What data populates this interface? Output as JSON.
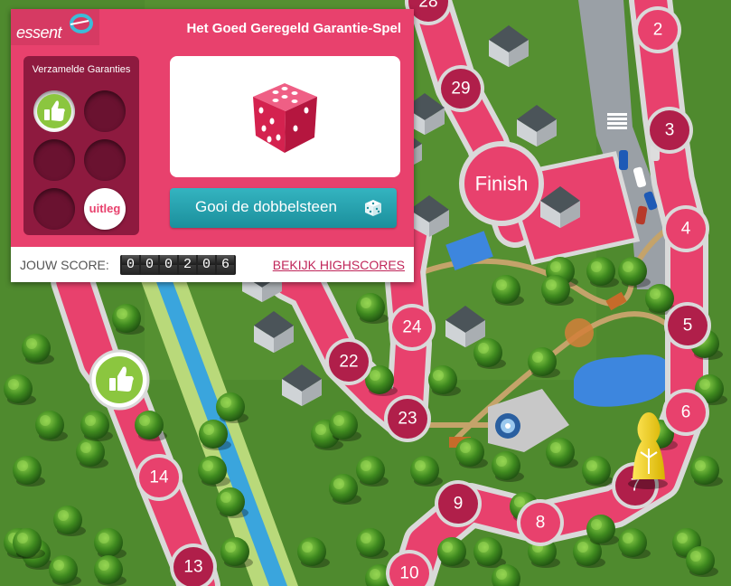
{
  "panel": {
    "logo": "essent",
    "title": "Het Goed Geregeld Garantie-Spel",
    "collected_title": "Verzamelde Garanties",
    "badge_text": "Goed Geregeld Garantie",
    "help_button": "uitleg",
    "roll_button": "Gooi de dobbelsteen",
    "score_label": "JOUW SCORE:",
    "score_digits": [
      "0",
      "0",
      "0",
      "2",
      "0",
      "6"
    ],
    "highscores_link": "BEKIJK HIGHSCORES"
  },
  "board": {
    "finish_label": "Finish",
    "tiles": [
      "2",
      "3",
      "4",
      "5",
      "6",
      "7",
      "8",
      "9",
      "10",
      "13",
      "14",
      "22",
      "23",
      "24",
      "28",
      "29"
    ],
    "board_badge_text": "Goed Geregeld Garantie"
  },
  "colors": {
    "brand": "#e8416d",
    "brand_dark": "#8e1a3f",
    "button": "#1e98a6",
    "grass": "#4f8a2e",
    "canal": "#3aa5dd",
    "pawn": "#f2d21e"
  },
  "icons": [
    "dice-icon",
    "thumbs-up-icon",
    "pawn-icon",
    "windmill-icon",
    "car-icon",
    "tree-icon",
    "house-icon",
    "fountain-icon"
  ]
}
